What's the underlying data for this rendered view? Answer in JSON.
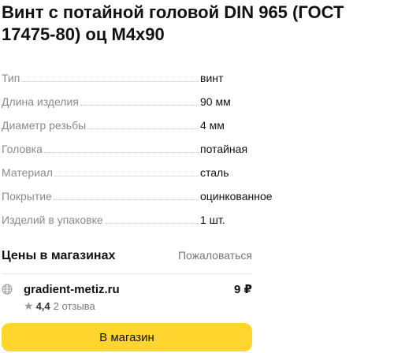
{
  "product": {
    "title": "Винт с потайной головой DIN 965 (ГОСТ 17475-80) оц М4х90"
  },
  "specs": [
    {
      "name": "Тип",
      "value": "винт"
    },
    {
      "name": "Длина изделия",
      "value": "90 мм"
    },
    {
      "name": "Диаметр резьбы",
      "value": "4 мм"
    },
    {
      "name": "Головка",
      "value": "потайная"
    },
    {
      "name": "Материал",
      "value": "сталь"
    },
    {
      "name": "Покрытие",
      "value": "оцинкованное"
    },
    {
      "name": "Изделий в упаковке",
      "value": "1 шт."
    }
  ],
  "prices": {
    "title": "Цены в магазинах",
    "complain_label": "Пожаловаться"
  },
  "shop": {
    "icon": "globe-icon",
    "name": "gradient-metiz.ru",
    "price": "9 ₽",
    "rating": "4,4",
    "reviews": "2 отзыва",
    "button_label": "В магазин"
  },
  "colors": {
    "button_bg": "#ffd52e",
    "label_gray": "#8a8a8a"
  }
}
